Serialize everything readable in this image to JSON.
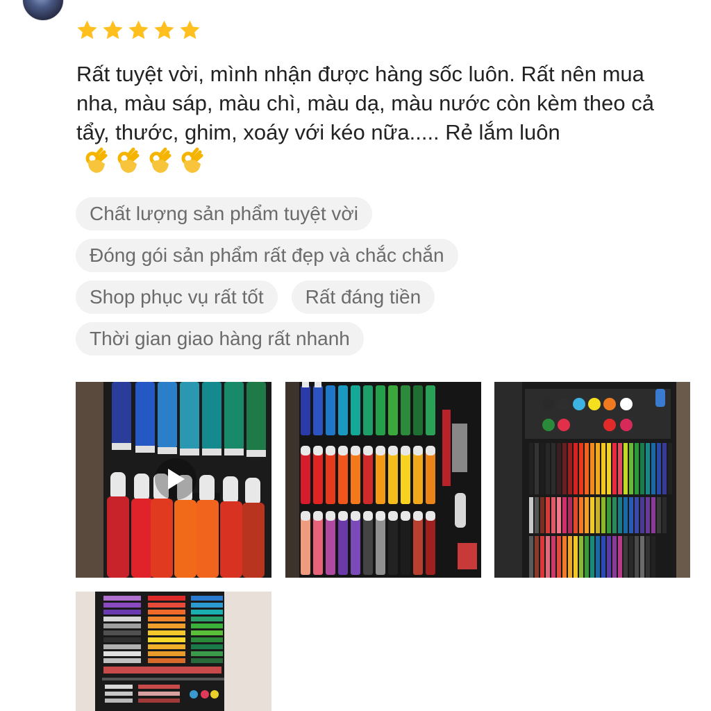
{
  "review": {
    "rating": 5,
    "text": "Rất tuyệt vời, mình nhận được hàng sốc luôn. Rất nên mua nha, màu sáp, màu chì, màu dạ, màu nước còn kèm theo cả tẩy, thước, ghim, xoáy với kéo nữa..... Rẻ lắm luôn",
    "emojis": [
      "👌",
      "👌",
      "👌",
      "👌"
    ]
  },
  "tags": [
    "Chất lượng sản phẩm tuyệt vời",
    "Đóng gói sản phẩm rất đẹp và chắc chắn",
    "Shop phục vụ rất tốt",
    "Rất đáng tiền",
    "Thời gian giao hàng rất nhanh"
  ],
  "icons": {
    "star": "star-icon",
    "play": "play-icon",
    "emoji": "ok-hand-emoji",
    "more": "more-icon"
  },
  "colors": {
    "star": "#FFBF1F",
    "tag_bg": "#F2F2F2",
    "tag_text": "#6B6B6B",
    "text": "#222222"
  }
}
